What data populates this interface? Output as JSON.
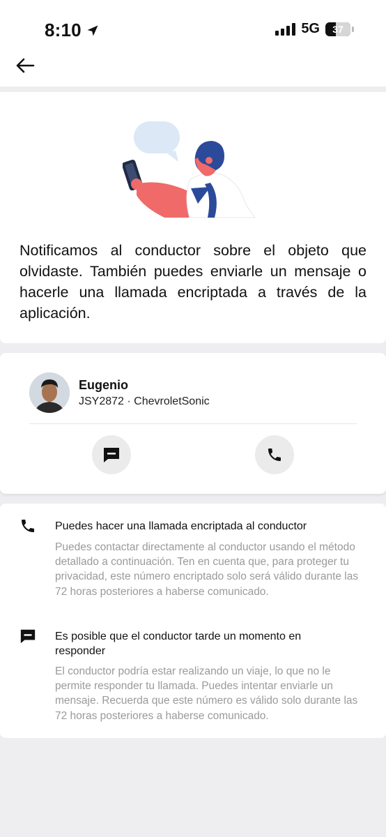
{
  "status_bar": {
    "time": "8:10",
    "network": "5G",
    "battery": "37"
  },
  "notice": {
    "text": "Notificamos al conductor sobre el objeto que olvidaste. También puedes enviarle un mensaje o hacerle una llamada encriptada a través de la aplicación."
  },
  "driver": {
    "name": "Eugenio",
    "vehicle": "JSY2872 · ChevroletSonic"
  },
  "info": [
    {
      "icon": "phone-icon",
      "title": "Puedes hacer una llamada encriptada al conductor",
      "body": "Puedes contactar directamente al conductor usando el método detallado a continuación. Ten en cuenta que, para proteger tu privacidad, este número encriptado solo será válido durante las 72 horas posteriores a haberse comunicado."
    },
    {
      "icon": "message-icon",
      "title": "Es posible que el conductor tarde un momento en responder",
      "body": "El conductor podría estar realizando un viaje, lo que no le permite responder tu llamada. Puedes intentar enviarle un mensaje. Recuerda que este número es válido solo durante las 72 horas posteriores a haberse comunicado."
    }
  ],
  "colors": {
    "accent_blue": "#2c4a9a",
    "accent_red": "#f06a6a",
    "page_bg": "#eeeef0"
  }
}
